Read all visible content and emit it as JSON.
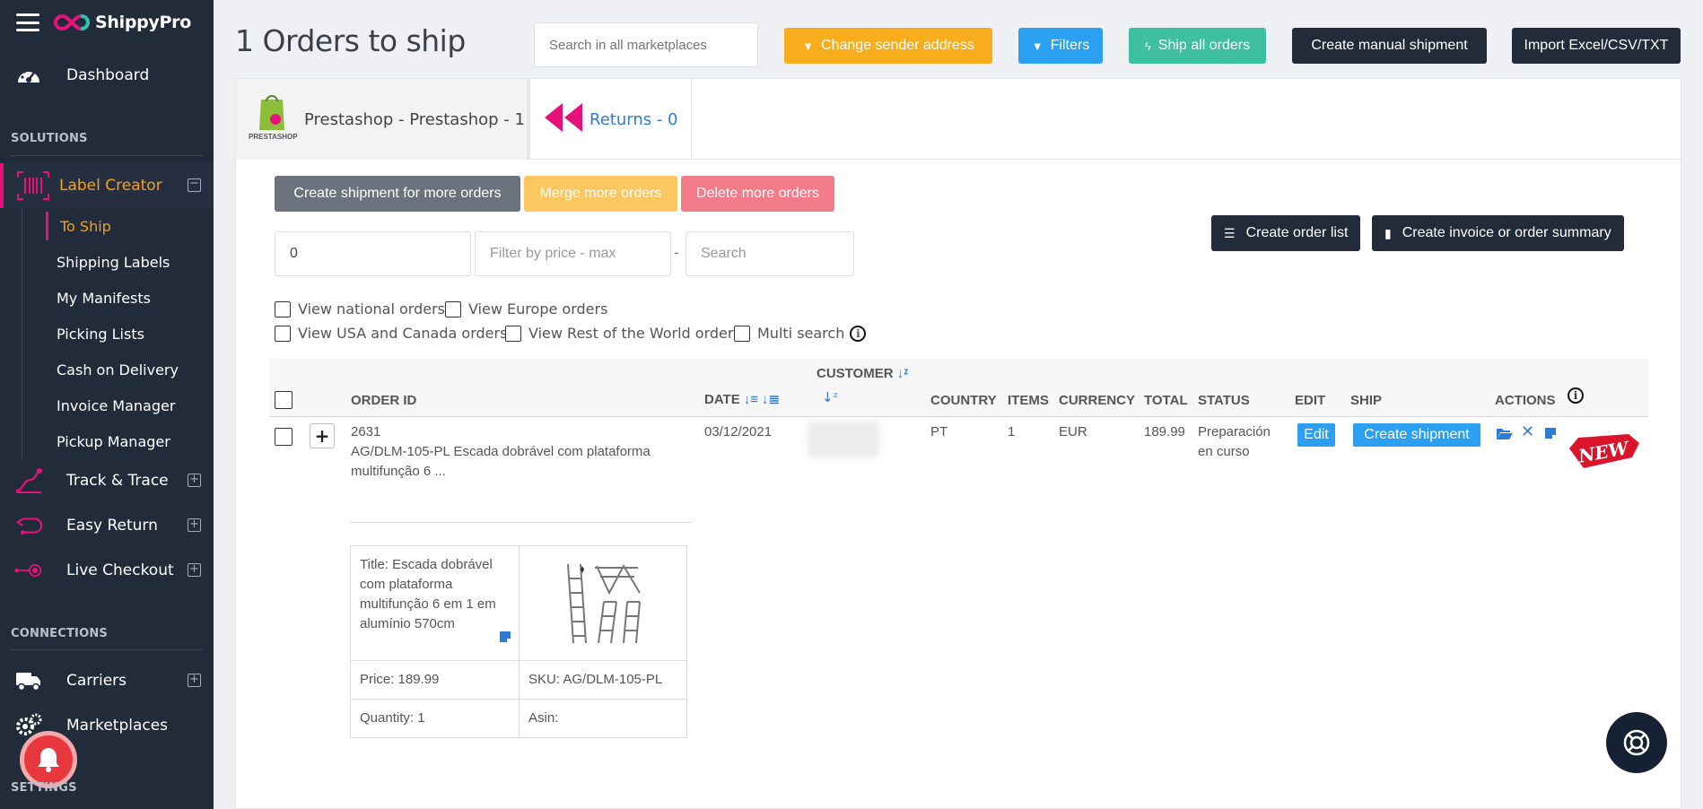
{
  "brand": {
    "name": "ShippyPro"
  },
  "sidebar": {
    "dashboard": "Dashboard",
    "solutions_heading": "SOLUTIONS",
    "label_creator": "Label Creator",
    "sub_items": [
      "To Ship",
      "Shipping Labels",
      "My Manifests",
      "Picking Lists",
      "Cash on Delivery",
      "Invoice Manager",
      "Pickup Manager"
    ],
    "track_trace": "Track & Trace",
    "easy_return": "Easy Return",
    "live_checkout": "Live Checkout",
    "connections_heading": "CONNECTIONS",
    "carriers": "Carriers",
    "marketplaces": "Marketplaces",
    "settings_heading": "SETTINGS"
  },
  "header": {
    "title": "1 Orders to ship",
    "search_placeholder": "Search in all marketplaces",
    "change_sender": "Change sender address",
    "filters": "Filters",
    "ship_all": "Ship all orders",
    "create_manual": "Create manual shipment",
    "import": "Import Excel/CSV/TXT"
  },
  "tabs": {
    "prestashop": "Prestashop - Prestashop - 1",
    "prestashop_logo_text": "PRESTASHOP",
    "returns": "Returns - 0"
  },
  "actions": {
    "create_shipment_more": "Create shipment for more orders",
    "merge_more": "Merge more orders",
    "delete_more": "Delete more orders",
    "create_order_list": "Create order list",
    "create_invoice": "Create invoice or order summary"
  },
  "filters": {
    "price_min_value": "0",
    "price_max_placeholder": "Filter by price - max",
    "dash": "-",
    "search_placeholder": "Search",
    "national": "View national orders",
    "europe": "View Europe orders",
    "usa_canada": "View USA and Canada orders",
    "rest_world": "View Rest of the World orders",
    "multi_search": "Multi search"
  },
  "table": {
    "headers": {
      "order_id": "ORDER ID",
      "date": "DATE",
      "customer": "CUSTOMER",
      "country": "COUNTRY",
      "items": "ITEMS",
      "currency": "CURRENCY",
      "total": "TOTAL",
      "status": "STATUS",
      "edit": "EDIT",
      "ship": "SHIP",
      "actions": "ACTIONS"
    },
    "row": {
      "order_id": "2631",
      "description_line1": "AG/DLM-105-PL Escada dobrável com plataforma",
      "description_line2": "multifunção 6 ...",
      "date": "03/12/2021",
      "country": "PT",
      "items": "1",
      "currency": "EUR",
      "total": "189.99",
      "status_line1": "Preparación",
      "status_line2": "en curso",
      "edit_label": "Edit",
      "ship_label": "Create shipment",
      "new_badge": "NEW"
    },
    "detail": {
      "title": "Title: Escada dobrável com plataforma multifunção 6 em 1 em alumínio 570cm",
      "price": "Price: 189.99",
      "sku": "SKU: AG/DLM-105-PL",
      "quantity": "Quantity: 1",
      "asin": "Asin:"
    }
  },
  "colors": {
    "sidebar_bg": "#222b3a",
    "accent_pink": "#e6127a",
    "accent_orange": "#f4a11d",
    "btn_yellow": "#f8ad1c",
    "btn_blue": "#2b9ff0",
    "btn_green": "#3dbfa0",
    "btn_dark": "#222b3a",
    "btn_grey": "#6c727c",
    "btn_light_yellow": "#fcc660",
    "btn_light_red": "#f47c8a"
  }
}
